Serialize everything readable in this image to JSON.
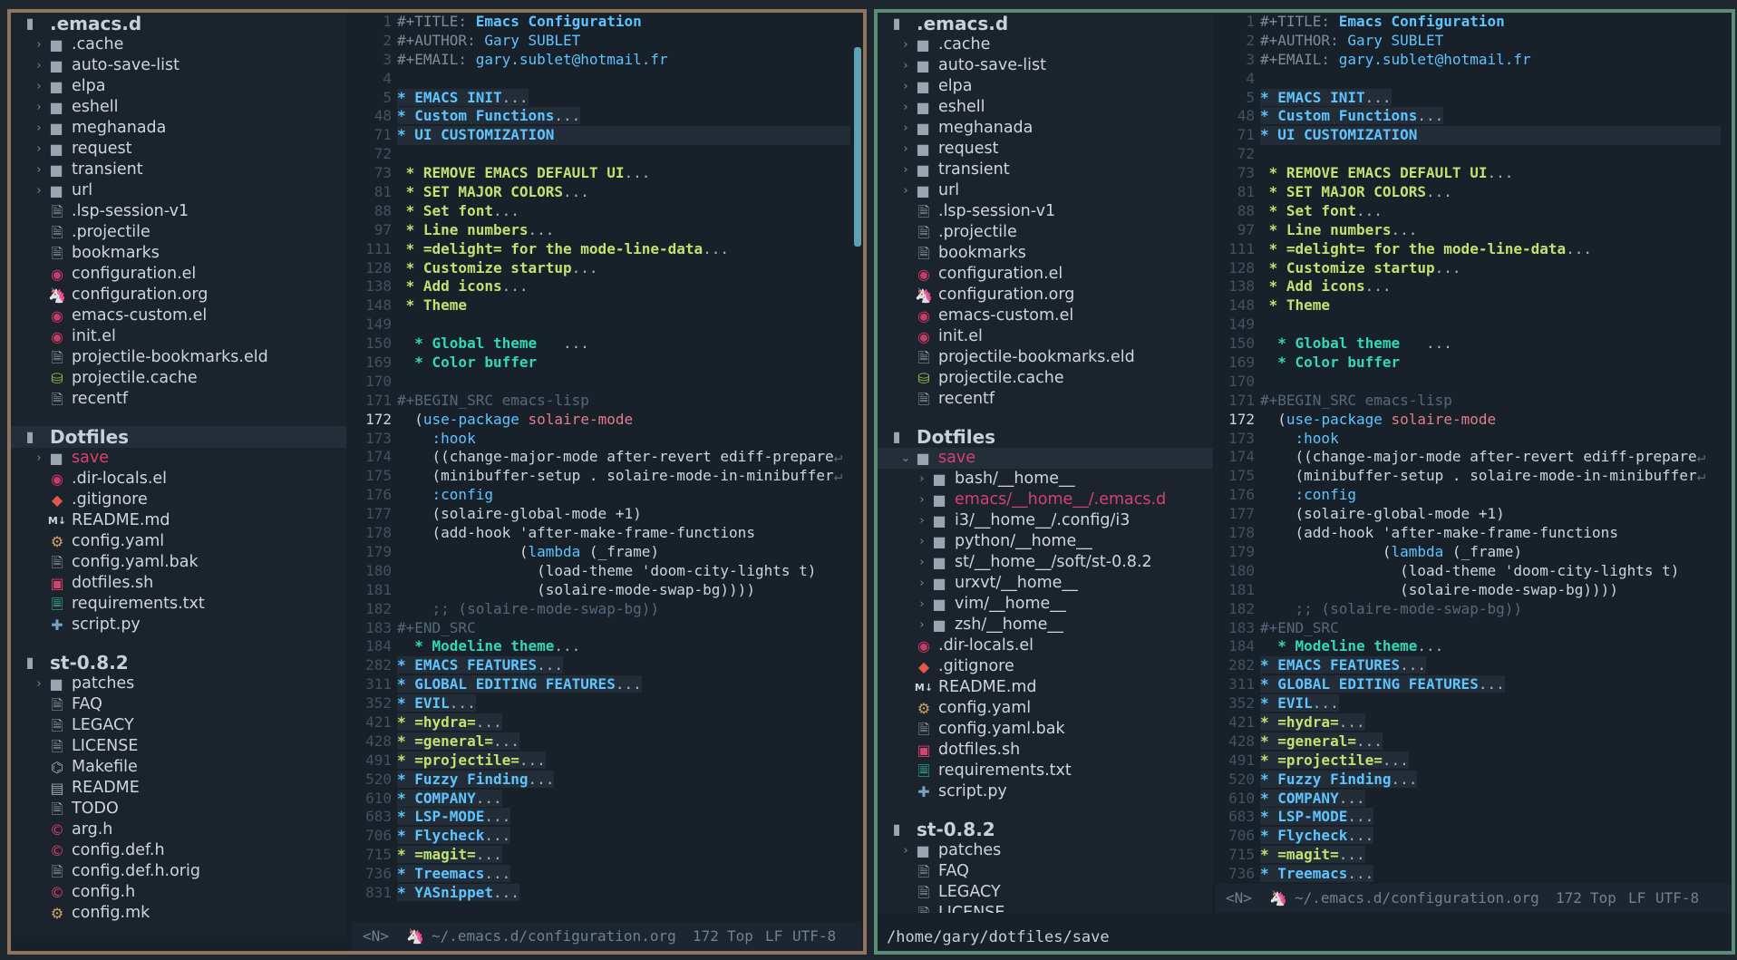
{
  "left_window": {
    "tree": [
      {
        "kind": "header",
        "label": ".emacs.d"
      },
      {
        "kind": "dir",
        "label": ".cache",
        "open": false
      },
      {
        "kind": "dir",
        "label": "auto-save-list",
        "open": false
      },
      {
        "kind": "dir",
        "label": "elpa",
        "open": false
      },
      {
        "kind": "dir",
        "label": "eshell",
        "open": false
      },
      {
        "kind": "dir",
        "label": "meghanada",
        "open": false
      },
      {
        "kind": "dir",
        "label": "request",
        "open": false
      },
      {
        "kind": "dir",
        "label": "transient",
        "open": false
      },
      {
        "kind": "dir",
        "label": "url",
        "open": false
      },
      {
        "kind": "file",
        "label": ".lsp-session-v1",
        "icon": "file-icon"
      },
      {
        "kind": "file",
        "label": ".projectile",
        "icon": "file-icon"
      },
      {
        "kind": "file",
        "label": "bookmarks",
        "icon": "file-icon"
      },
      {
        "kind": "file",
        "label": "configuration.el",
        "icon": "emacs-icon"
      },
      {
        "kind": "file",
        "label": "configuration.org",
        "icon": "org-unicorn-icon"
      },
      {
        "kind": "file",
        "label": "emacs-custom.el",
        "icon": "emacs-icon"
      },
      {
        "kind": "file",
        "label": "init.el",
        "icon": "emacs-icon"
      },
      {
        "kind": "file",
        "label": "projectile-bookmarks.eld",
        "icon": "file-icon"
      },
      {
        "kind": "file",
        "label": "projectile.cache",
        "icon": "database-icon"
      },
      {
        "kind": "file",
        "label": "recentf",
        "icon": "file-icon"
      },
      {
        "kind": "gap"
      },
      {
        "kind": "header",
        "label": "Dotfiles",
        "highlight": true
      },
      {
        "kind": "dir",
        "label": "save",
        "open": false,
        "red": true
      },
      {
        "kind": "file",
        "label": ".dir-locals.el",
        "icon": "emacs-icon"
      },
      {
        "kind": "file",
        "label": ".gitignore",
        "icon": "git-icon"
      },
      {
        "kind": "file",
        "label": "README.md",
        "icon": "markdown-icon"
      },
      {
        "kind": "file",
        "label": "config.yaml",
        "icon": "settings-icon"
      },
      {
        "kind": "file",
        "label": "config.yaml.bak",
        "icon": "file-icon"
      },
      {
        "kind": "file",
        "label": "dotfiles.sh",
        "icon": "terminal-icon"
      },
      {
        "kind": "file",
        "label": "requirements.txt",
        "icon": "text-file-icon"
      },
      {
        "kind": "file",
        "label": "script.py",
        "icon": "python-icon"
      },
      {
        "kind": "gap"
      },
      {
        "kind": "header",
        "label": "st-0.8.2"
      },
      {
        "kind": "dir",
        "label": "patches",
        "open": false
      },
      {
        "kind": "file",
        "label": "FAQ",
        "icon": "file-icon"
      },
      {
        "kind": "file",
        "label": "LEGACY",
        "icon": "file-icon"
      },
      {
        "kind": "file",
        "label": "LICENSE",
        "icon": "file-icon"
      },
      {
        "kind": "file",
        "label": "Makefile",
        "icon": "makefile-icon"
      },
      {
        "kind": "file",
        "label": "README",
        "icon": "readme-icon"
      },
      {
        "kind": "file",
        "label": "TODO",
        "icon": "file-icon"
      },
      {
        "kind": "file",
        "label": "arg.h",
        "icon": "c-icon"
      },
      {
        "kind": "file",
        "label": "config.def.h",
        "icon": "c-icon"
      },
      {
        "kind": "file",
        "label": "config.def.h.orig",
        "icon": "file-icon"
      },
      {
        "kind": "file",
        "label": "config.h",
        "icon": "c-icon"
      },
      {
        "kind": "file",
        "label": "config.mk",
        "icon": "settings-icon"
      }
    ]
  },
  "right_window": {
    "tree": [
      {
        "kind": "header",
        "label": ".emacs.d"
      },
      {
        "kind": "dir",
        "label": ".cache",
        "open": false
      },
      {
        "kind": "dir",
        "label": "auto-save-list",
        "open": false
      },
      {
        "kind": "dir",
        "label": "elpa",
        "open": false
      },
      {
        "kind": "dir",
        "label": "eshell",
        "open": false
      },
      {
        "kind": "dir",
        "label": "meghanada",
        "open": false
      },
      {
        "kind": "dir",
        "label": "request",
        "open": false
      },
      {
        "kind": "dir",
        "label": "transient",
        "open": false
      },
      {
        "kind": "dir",
        "label": "url",
        "open": false
      },
      {
        "kind": "file",
        "label": ".lsp-session-v1",
        "icon": "file-icon"
      },
      {
        "kind": "file",
        "label": ".projectile",
        "icon": "file-icon"
      },
      {
        "kind": "file",
        "label": "bookmarks",
        "icon": "file-icon"
      },
      {
        "kind": "file",
        "label": "configuration.el",
        "icon": "emacs-icon"
      },
      {
        "kind": "file",
        "label": "configuration.org",
        "icon": "org-unicorn-icon"
      },
      {
        "kind": "file",
        "label": "emacs-custom.el",
        "icon": "emacs-icon"
      },
      {
        "kind": "file",
        "label": "init.el",
        "icon": "emacs-icon"
      },
      {
        "kind": "file",
        "label": "projectile-bookmarks.eld",
        "icon": "file-icon"
      },
      {
        "kind": "file",
        "label": "projectile.cache",
        "icon": "database-icon"
      },
      {
        "kind": "file",
        "label": "recentf",
        "icon": "file-icon"
      },
      {
        "kind": "gap"
      },
      {
        "kind": "header",
        "label": "Dotfiles"
      },
      {
        "kind": "dir",
        "label": "save",
        "open": true,
        "red": true,
        "highlight": true
      },
      {
        "kind": "subdir",
        "label": "bash/__home__"
      },
      {
        "kind": "subdir",
        "label": "emacs/__home__/.emacs.d",
        "red": true
      },
      {
        "kind": "subdir",
        "label": "i3/__home__/.config/i3"
      },
      {
        "kind": "subdir",
        "label": "python/__home__"
      },
      {
        "kind": "subdir",
        "label": "st/__home__/soft/st-0.8.2"
      },
      {
        "kind": "subdir",
        "label": "urxvt/__home__"
      },
      {
        "kind": "subdir",
        "label": "vim/__home__"
      },
      {
        "kind": "subdir",
        "label": "zsh/__home__"
      },
      {
        "kind": "file",
        "label": ".dir-locals.el",
        "icon": "emacs-icon"
      },
      {
        "kind": "file",
        "label": ".gitignore",
        "icon": "git-icon"
      },
      {
        "kind": "file",
        "label": "README.md",
        "icon": "markdown-icon"
      },
      {
        "kind": "file",
        "label": "config.yaml",
        "icon": "settings-icon"
      },
      {
        "kind": "file",
        "label": "config.yaml.bak",
        "icon": "file-icon"
      },
      {
        "kind": "file",
        "label": "dotfiles.sh",
        "icon": "terminal-icon"
      },
      {
        "kind": "file",
        "label": "requirements.txt",
        "icon": "text-file-icon"
      },
      {
        "kind": "file",
        "label": "script.py",
        "icon": "python-icon"
      },
      {
        "kind": "gap"
      },
      {
        "kind": "header",
        "label": "st-0.8.2"
      },
      {
        "kind": "dir",
        "label": "patches",
        "open": false
      },
      {
        "kind": "file",
        "label": "FAQ",
        "icon": "file-icon"
      },
      {
        "kind": "file",
        "label": "LEGACY",
        "icon": "file-icon"
      },
      {
        "kind": "file",
        "label": "LICENSE",
        "icon": "file-icon"
      }
    ]
  },
  "editor": {
    "current_line": "172",
    "lines": [
      {
        "n": "1",
        "parts": [
          [
            "#+TITLE: ",
            "key"
          ],
          [
            "Emacs Configuration",
            "keyv"
          ]
        ]
      },
      {
        "n": "2",
        "parts": [
          [
            "#+AUTHOR: ",
            "key"
          ],
          [
            "Gary SUBLET",
            "meta"
          ]
        ]
      },
      {
        "n": "3",
        "parts": [
          [
            "#+EMAIL: ",
            "key"
          ],
          [
            "gary.sublet@hotmail.fr",
            "meta"
          ]
        ]
      },
      {
        "n": "4",
        "parts": []
      },
      {
        "n": "5",
        "band": true,
        "parts": [
          [
            "* EMACS INIT",
            "h1"
          ],
          [
            "...",
            "ell"
          ]
        ]
      },
      {
        "n": "48",
        "band": true,
        "parts": [
          [
            "* Custom Functions",
            "h1"
          ],
          [
            "...",
            "ell"
          ]
        ]
      },
      {
        "n": "71",
        "band": true,
        "full": true,
        "parts": [
          [
            "* UI CUSTOMIZATION",
            "h1"
          ]
        ]
      },
      {
        "n": "72",
        "parts": []
      },
      {
        "n": "73",
        "parts": [
          [
            " * REMOVE EMACS DEFAULT UI",
            "h2"
          ],
          [
            "...",
            "ell"
          ]
        ]
      },
      {
        "n": "81",
        "parts": [
          [
            " * SET MAJOR COLORS",
            "h2"
          ],
          [
            "...",
            "ell"
          ]
        ]
      },
      {
        "n": "88",
        "parts": [
          [
            " * Set font",
            "h2"
          ],
          [
            "...",
            "ell"
          ]
        ]
      },
      {
        "n": "97",
        "parts": [
          [
            " * Line numbers",
            "h2"
          ],
          [
            "...",
            "ell"
          ]
        ]
      },
      {
        "n": "111",
        "parts": [
          [
            " * =delight= for the mode-line-data",
            "h2"
          ],
          [
            "...",
            "ell"
          ]
        ]
      },
      {
        "n": "128",
        "parts": [
          [
            " * Customize startup",
            "h2"
          ],
          [
            "...",
            "ell"
          ]
        ]
      },
      {
        "n": "138",
        "parts": [
          [
            " * Add icons",
            "h2"
          ],
          [
            "...",
            "ell"
          ]
        ]
      },
      {
        "n": "148",
        "parts": [
          [
            " * Theme",
            "h2"
          ]
        ]
      },
      {
        "n": "149",
        "parts": []
      },
      {
        "n": "150",
        "parts": [
          [
            "  * Global theme   ",
            "h3"
          ],
          [
            "...",
            "ell"
          ]
        ]
      },
      {
        "n": "169",
        "parts": [
          [
            "  * Color buffer",
            "h3"
          ]
        ]
      },
      {
        "n": "170",
        "parts": []
      },
      {
        "n": "171",
        "parts": [
          [
            "#+BEGIN_SRC emacs-lisp",
            "cm"
          ]
        ]
      },
      {
        "n": "172",
        "parts": [
          [
            "  (",
            "pl"
          ],
          [
            "use-package",
            "kw"
          ],
          [
            " ",
            "pl"
          ],
          [
            "solaire-mode",
            "red"
          ]
        ]
      },
      {
        "n": "173",
        "parts": [
          [
            "    :hook",
            "kw"
          ]
        ]
      },
      {
        "n": "174",
        "parts": [
          [
            "    ((change-major-mode after-revert ediff-prepare",
            "pl"
          ],
          [
            "↵",
            "cm"
          ]
        ]
      },
      {
        "n": "175",
        "parts": [
          [
            "    (minibuffer-setup . solaire-mode-in-minibuffer",
            "pl"
          ],
          [
            "↵",
            "cm"
          ]
        ]
      },
      {
        "n": "176",
        "parts": [
          [
            "    :config",
            "kw"
          ]
        ]
      },
      {
        "n": "177",
        "parts": [
          [
            "    (solaire-global-mode +1)",
            "pl"
          ]
        ]
      },
      {
        "n": "178",
        "parts": [
          [
            "    (add-hook 'after-make-frame-functions",
            "pl"
          ]
        ]
      },
      {
        "n": "179",
        "parts": [
          [
            "              (",
            "pl"
          ],
          [
            "lambda",
            "kw"
          ],
          [
            " (_frame)",
            "pl"
          ]
        ]
      },
      {
        "n": "180",
        "parts": [
          [
            "                (load-theme 'doom-city-lights t)",
            "pl"
          ]
        ]
      },
      {
        "n": "181",
        "parts": [
          [
            "                (solaire-mode-swap-bg))))",
            "pl"
          ]
        ]
      },
      {
        "n": "182",
        "parts": [
          [
            "    ;; (solaire-mode-swap-bg))",
            "cm"
          ]
        ]
      },
      {
        "n": "183",
        "parts": [
          [
            "#+END_SRC",
            "cm"
          ]
        ]
      },
      {
        "n": "184",
        "parts": [
          [
            "  * Modeline theme",
            "h3"
          ],
          [
            "...",
            "ell"
          ]
        ]
      },
      {
        "n": "282",
        "band": true,
        "parts": [
          [
            "* EMACS FEATURES",
            "h1"
          ],
          [
            "...",
            "ell"
          ]
        ]
      },
      {
        "n": "311",
        "band": true,
        "parts": [
          [
            "* GLOBAL EDITING FEATURES",
            "h1"
          ],
          [
            "...",
            "ell"
          ]
        ]
      },
      {
        "n": "352",
        "band": true,
        "parts": [
          [
            "* EVIL",
            "h1"
          ],
          [
            "...",
            "ell"
          ]
        ]
      },
      {
        "n": "421",
        "band": true,
        "parts": [
          [
            "* =hydra=",
            "h2"
          ],
          [
            "...",
            "ell"
          ]
        ]
      },
      {
        "n": "428",
        "band": true,
        "parts": [
          [
            "* =general=",
            "h2"
          ],
          [
            "...",
            "ell"
          ]
        ]
      },
      {
        "n": "491",
        "band": true,
        "parts": [
          [
            "* =projectile=",
            "h2"
          ],
          [
            "...",
            "ell"
          ]
        ]
      },
      {
        "n": "520",
        "band": true,
        "parts": [
          [
            "* Fuzzy Finding",
            "h1"
          ],
          [
            "...",
            "ell"
          ]
        ]
      },
      {
        "n": "610",
        "band": true,
        "parts": [
          [
            "* COMPANY",
            "h1"
          ],
          [
            "...",
            "ell"
          ]
        ]
      },
      {
        "n": "683",
        "band": true,
        "parts": [
          [
            "* LSP-MODE",
            "h1"
          ],
          [
            "...",
            "ell"
          ]
        ]
      },
      {
        "n": "706",
        "band": true,
        "parts": [
          [
            "* Flycheck",
            "h1"
          ],
          [
            "...",
            "ell"
          ]
        ]
      },
      {
        "n": "715",
        "band": true,
        "parts": [
          [
            "* =magit=",
            "h2"
          ],
          [
            "...",
            "ell"
          ]
        ]
      },
      {
        "n": "736",
        "band": true,
        "parts": [
          [
            "* Treemacs",
            "h1"
          ],
          [
            "...",
            "ell"
          ]
        ]
      },
      {
        "n": "831",
        "band": true,
        "parts": [
          [
            "* YASnippet",
            "h1"
          ],
          [
            "...",
            "ell"
          ]
        ]
      }
    ]
  },
  "modeline": {
    "state": "<N>",
    "path": "~/.emacs.d/configuration.org",
    "position": "172",
    "scroll": "Top",
    "eol": "LF",
    "encoding": "UTF-8"
  },
  "echo_area": "/home/gary/dotfiles/save",
  "colors": {
    "left_border": "#8f7560",
    "right_border": "#5b8c75",
    "background": "#18212a",
    "accent": "#5ec4ff",
    "heading_green": "#c2e26f",
    "heading_teal": "#33d7b6",
    "error_red": "#d6426e"
  }
}
